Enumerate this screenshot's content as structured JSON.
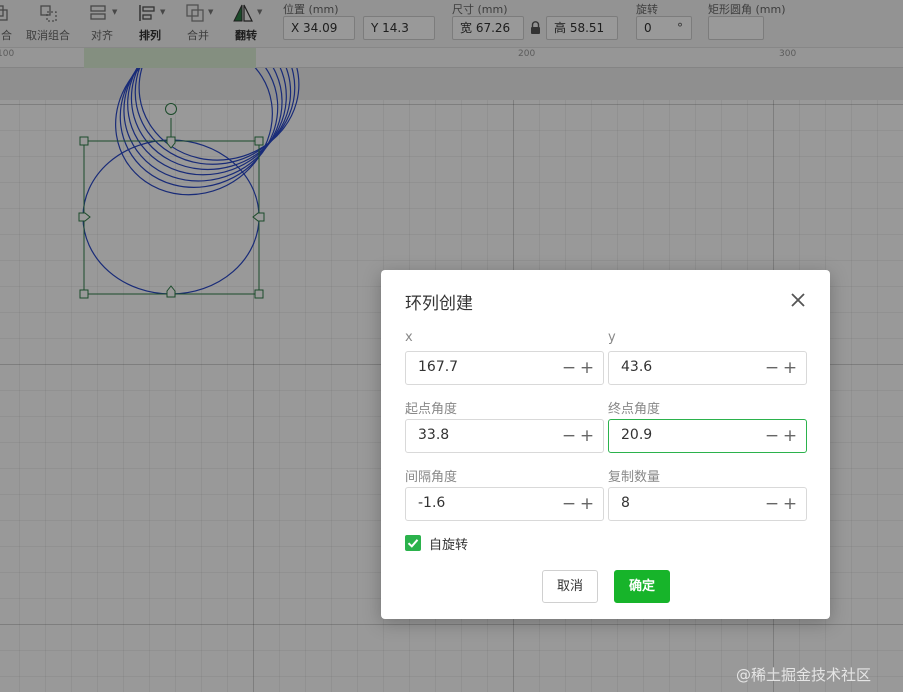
{
  "toolbar": {
    "tools": [
      {
        "id": "ungroup-partial",
        "label": "合"
      },
      {
        "id": "ungroup",
        "label": "取消组合"
      },
      {
        "id": "align",
        "label": "对齐"
      },
      {
        "id": "arrange",
        "label": "排列"
      },
      {
        "id": "merge",
        "label": "合并"
      },
      {
        "id": "flip",
        "label": "翻转"
      }
    ],
    "position_label": "位置 (mm)",
    "x_value": "X 34.09",
    "y_value": "Y 14.3",
    "size_label": "尺寸 (mm)",
    "width_value": "宽 67.26",
    "height_value": "高 58.51",
    "rotate_label": "旋转",
    "rotate_value": "0",
    "rotate_unit": "°",
    "radius_label": "矩形圆角 (mm)",
    "radius_value": ""
  },
  "ruler": {
    "marks": [
      "100",
      "200",
      "300"
    ]
  },
  "dialog": {
    "title": "环列创建",
    "fields": [
      {
        "label": "x",
        "value": "167.7"
      },
      {
        "label": "y",
        "value": "43.6"
      },
      {
        "label": "起点角度",
        "value": "33.8"
      },
      {
        "label": "终点角度",
        "value": "20.9"
      },
      {
        "label": "间隔角度",
        "value": "-1.6"
      },
      {
        "label": "复制数量",
        "value": "8"
      }
    ],
    "stepper_minus": "−",
    "stepper_plus": "+",
    "self_rotate_label": "自旋转",
    "self_rotate_checked": true,
    "cancel_label": "取消",
    "ok_label": "确定"
  },
  "watermark": "@稀土掘金技术社区",
  "colors": {
    "accent": "#17b42a",
    "shape_stroke": "#2a49c8",
    "selection": "#2e7d46"
  }
}
